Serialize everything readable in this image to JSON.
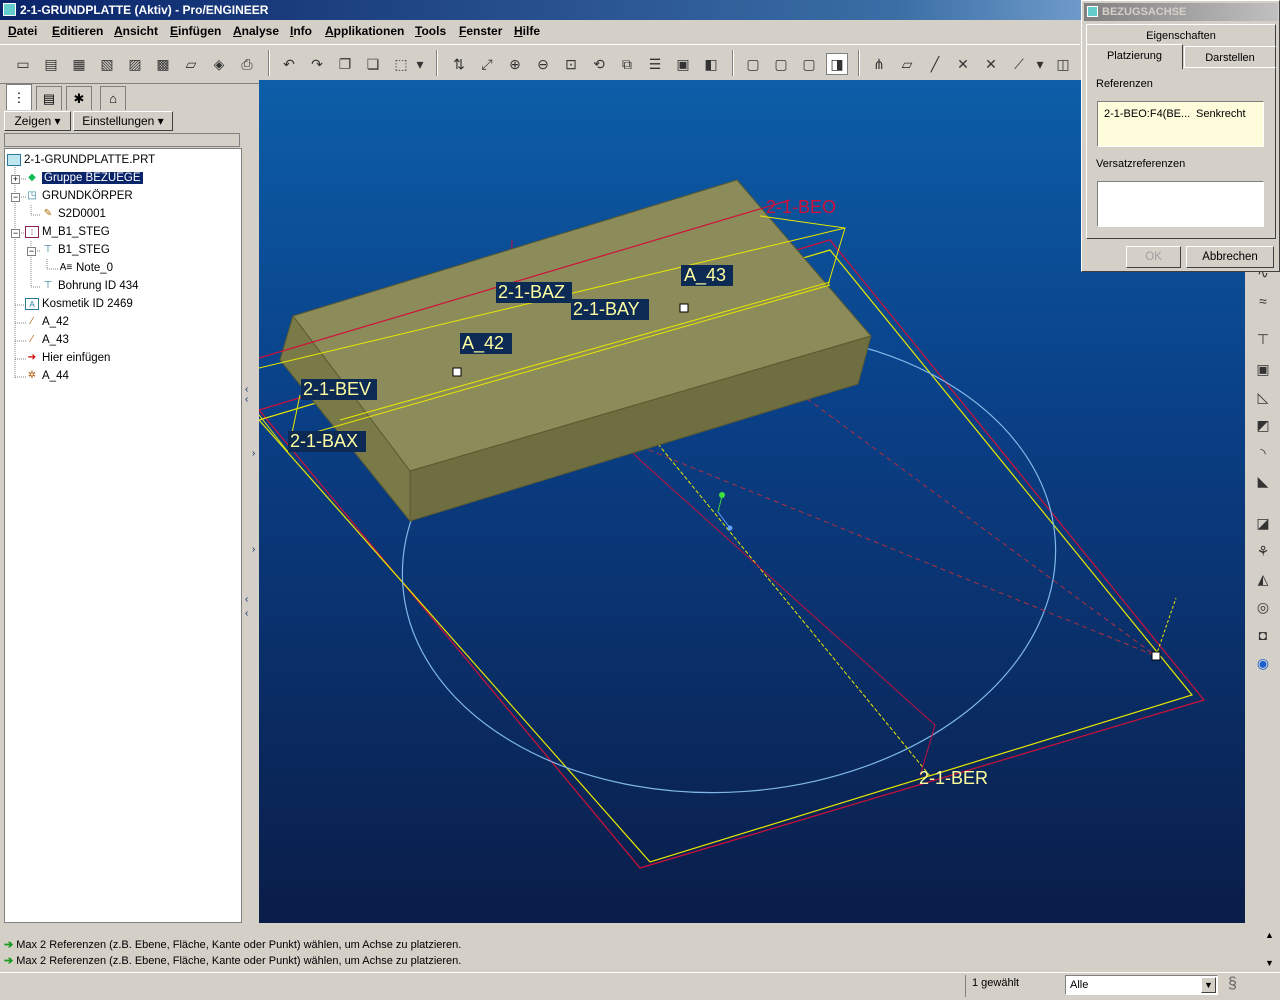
{
  "window": {
    "title": "2-1-GRUNDPLATTE (Aktiv) - Pro/ENGINEER"
  },
  "menu": [
    "Datei",
    "Editieren",
    "Ansicht",
    "Einfügen",
    "Analyse",
    "Info",
    "Applikationen",
    "Tools",
    "Fenster",
    "Hilfe"
  ],
  "panel": {
    "show_button": "Zeigen",
    "settings_button": "Einstellungen",
    "tree": [
      {
        "label": "2-1-GRUNDPLATTE.PRT",
        "icon": "part-icon"
      },
      {
        "label": "Gruppe BEZUEGE",
        "icon": "group-icon",
        "selected": true
      },
      {
        "label": "GRUNDKÖRPER",
        "icon": "protrusion-icon"
      },
      {
        "label": "S2D0001",
        "icon": "sketch-icon"
      },
      {
        "label": "M_B1_STEG",
        "icon": "pattern-icon"
      },
      {
        "label": "B1_STEG",
        "icon": "cut-icon"
      },
      {
        "label": "Note_0",
        "icon": "note-icon"
      },
      {
        "label": "Bohrung ID 434",
        "icon": "hole-icon"
      },
      {
        "label": "Kosmetik ID 2469",
        "icon": "cosmetic-icon"
      },
      {
        "label": "A_42",
        "icon": "axis-icon"
      },
      {
        "label": "A_43",
        "icon": "axis-icon"
      },
      {
        "label": "Hier einfügen",
        "icon": "insert-arrow-icon"
      },
      {
        "label": "A_44",
        "icon": "axis-new-icon"
      }
    ]
  },
  "viewport": {
    "labels": {
      "beo": "2-1-BEO",
      "baz": "2-1-BAZ",
      "bay": "2-1-BAY",
      "a43": "A_43",
      "a42": "A_42",
      "bev": "2-1-BEV",
      "bax": "2-1-BAX",
      "ber": "2-1-BER"
    },
    "colors": {
      "datum_yellow": "#ffff00",
      "datum_red": "#d0103a",
      "solid": "#8c8c5a",
      "circle": "#7fb8e8"
    }
  },
  "dialog": {
    "title": "BEZUGSACHSE",
    "tab_properties": "Eigenschaften",
    "tab_placement": "Platzierung",
    "tab_display": "Darstellen",
    "references_label": "Referenzen",
    "reference_item": "2-1-BEO:F4(BE...",
    "reference_constraint": "Senkrecht",
    "offset_label": "Versatzreferenzen",
    "ok": "OK",
    "cancel": "Abbrechen"
  },
  "messages": [
    "Max 2 Referenzen (z.B. Ebene, Fläche, Kante oder Punkt) wählen, um Achse zu platzieren.",
    "Max 2 Referenzen (z.B. Ebene, Fläche, Kante oder Punkt) wählen, um Achse zu platzieren."
  ],
  "status": {
    "selected": "1 gewählt",
    "filter": "Alle"
  }
}
